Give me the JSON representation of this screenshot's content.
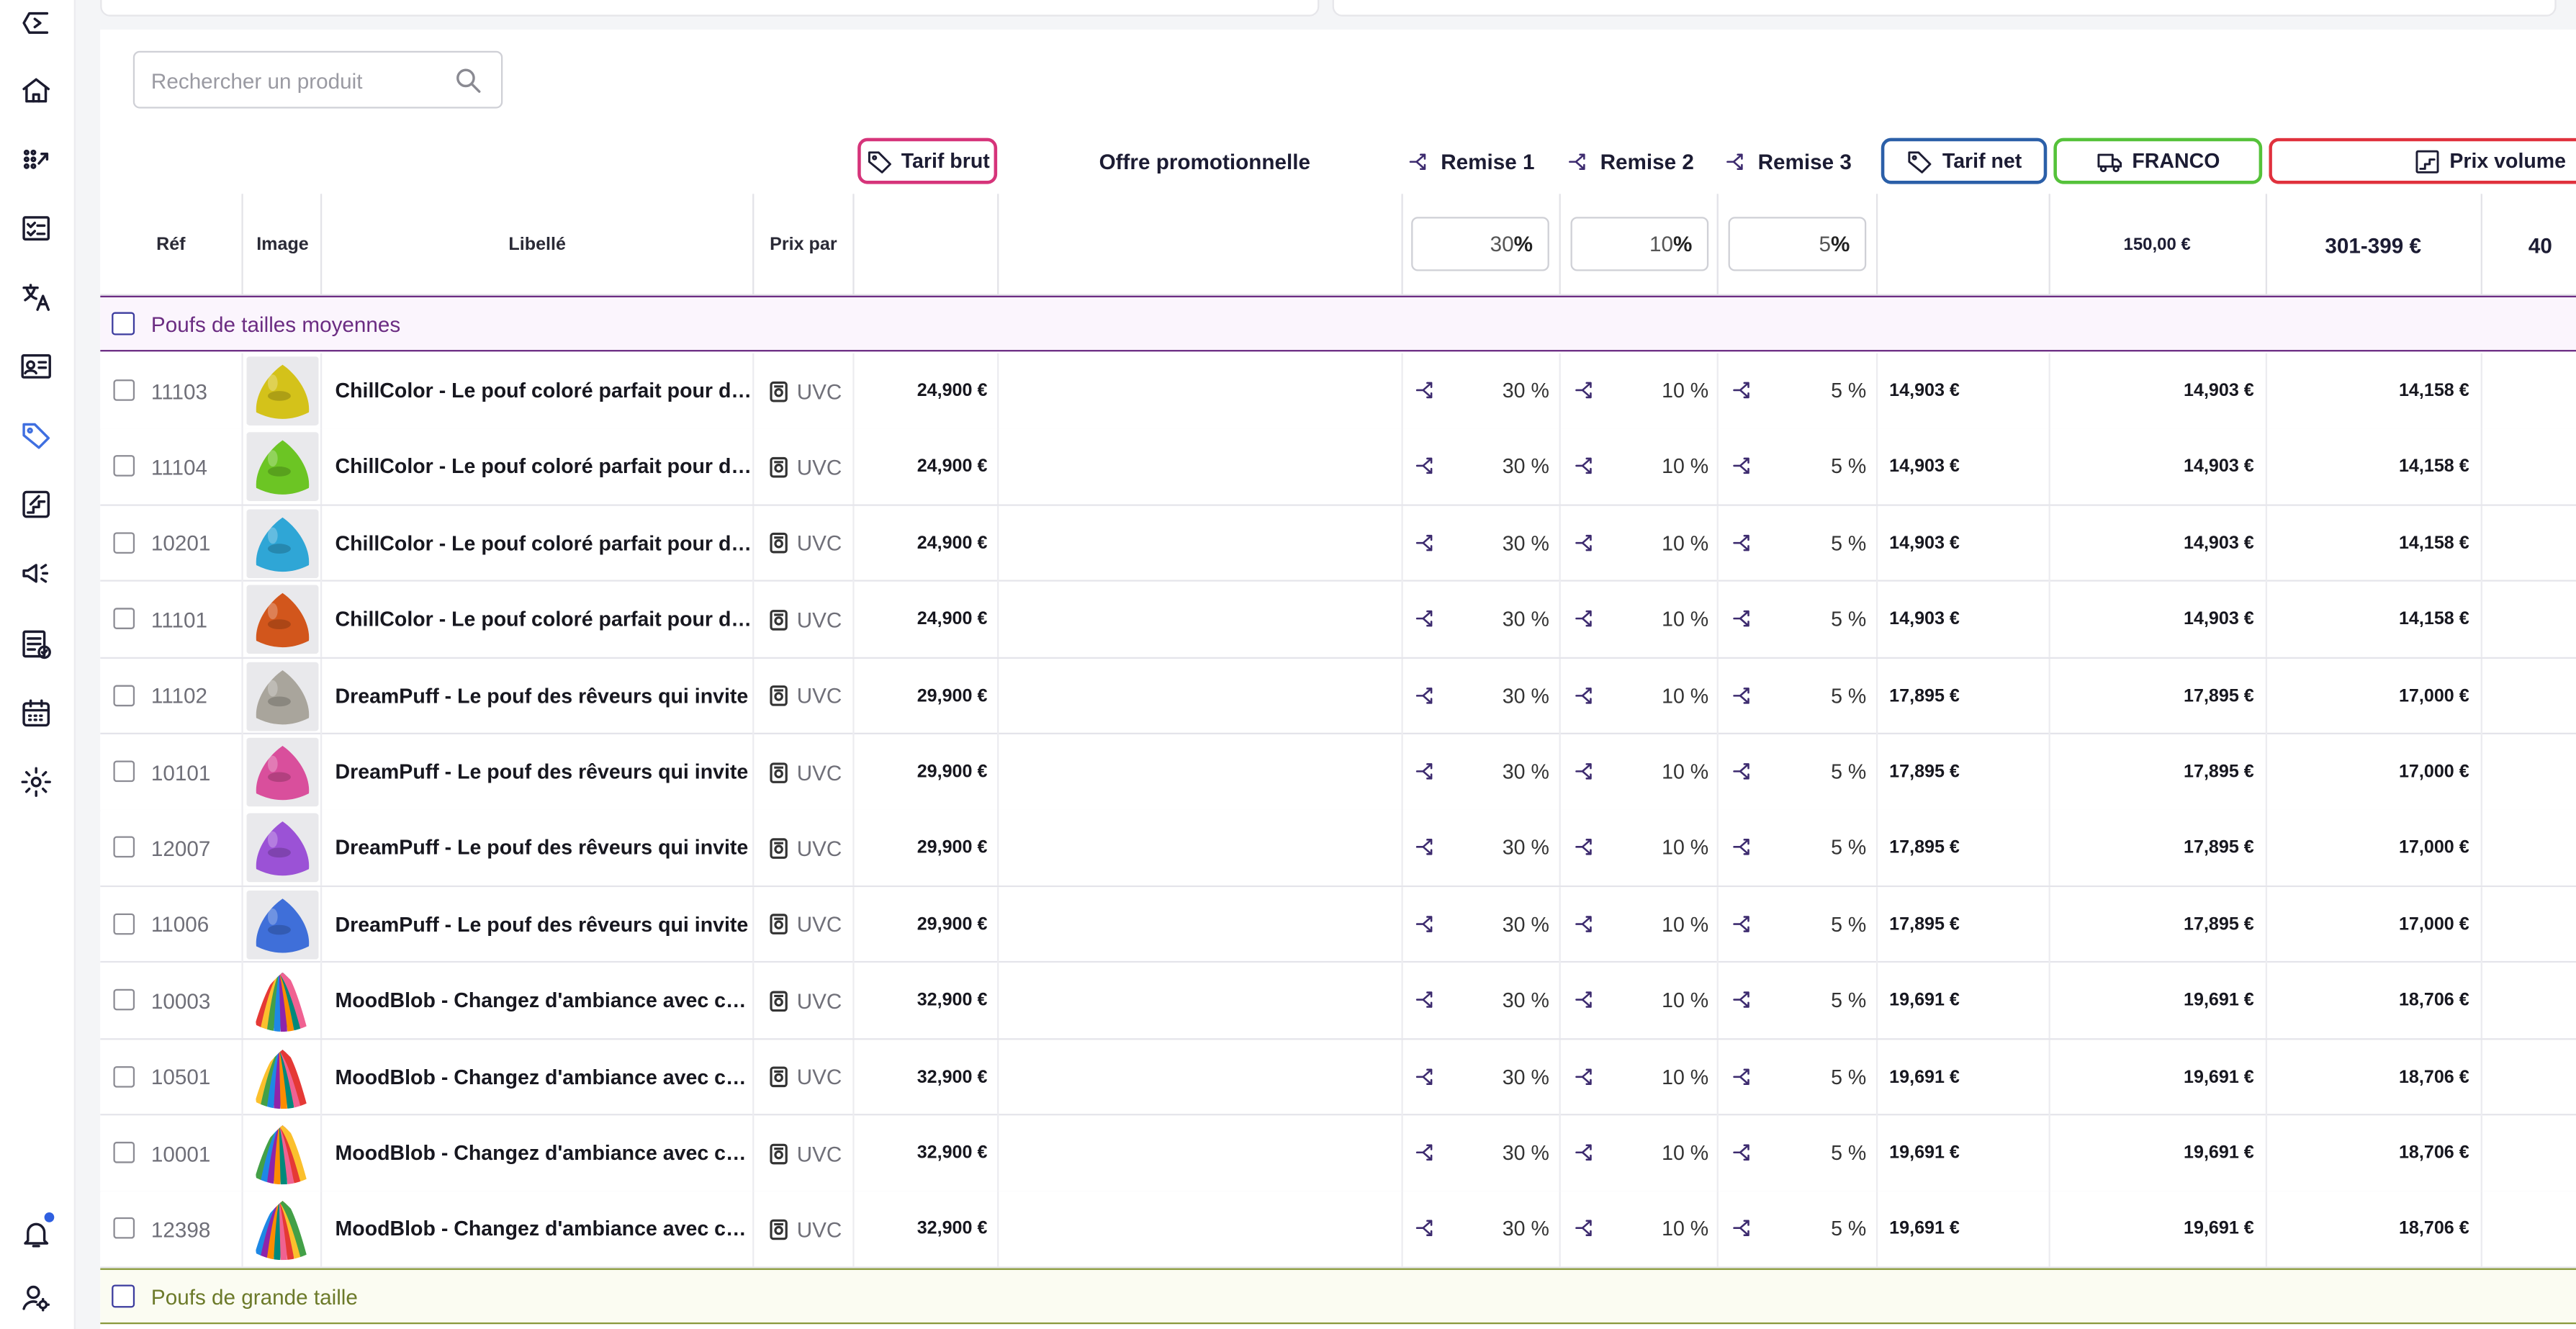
{
  "sidebar": {
    "items": [
      {
        "icon": "back-logo-icon"
      },
      {
        "icon": "home-icon"
      },
      {
        "icon": "dots-grid-icon"
      },
      {
        "icon": "checklist-icon"
      },
      {
        "icon": "translate-icon"
      },
      {
        "icon": "contact-card-icon"
      },
      {
        "icon": "price-tag-icon",
        "active": true
      },
      {
        "icon": "stairs-icon"
      },
      {
        "icon": "megaphone-icon"
      },
      {
        "icon": "document-check-icon"
      },
      {
        "icon": "calendar-icon"
      },
      {
        "icon": "settings-icon"
      }
    ],
    "bottom": [
      {
        "icon": "bell-icon"
      },
      {
        "icon": "user-settings-icon"
      }
    ]
  },
  "search": {
    "placeholder": "Rechercher un produit"
  },
  "header_groups": {
    "tarif_brut": "Tarif brut",
    "offre": "Offre promotionnelle",
    "remise1": "Remise 1",
    "remise2": "Remise 2",
    "remise3": "Remise 3",
    "tarif_net": "Tarif net",
    "franco": "FRANCO",
    "prix_volume": "Prix volume"
  },
  "columns": {
    "ref": "Réf",
    "image": "Image",
    "libelle": "Libellé",
    "prix_par": "Prix par",
    "remise1_value": "30",
    "remise2_value": "10",
    "remise3_value": "5",
    "pct_sign": "%",
    "franco_value": "150,00 €",
    "volume_range": "301-399 €",
    "volume_next": "40"
  },
  "colors": {
    "tarif_brut": "#d6347a",
    "tarif_net": "#2b5fa8",
    "franco": "#55c23a",
    "prix_volume": "#e0313d",
    "group1": "#6b2c82",
    "group2": "#8a9a3c"
  },
  "groups": [
    {
      "label": "Poufs de tailles moyennes"
    },
    {
      "label": "Poufs de grande taille"
    }
  ],
  "rows": [
    {
      "ref": "11103",
      "color": "#d4c21a",
      "libelle": "ChillColor - Le pouf coloré parfait pour détente",
      "unit": "UVC",
      "brut": "24,900 €",
      "r1": "30 %",
      "r2": "10 %",
      "r3": "5 %",
      "net": "14,903 €",
      "franco": "14,903 €",
      "vol": "14,158 €"
    },
    {
      "ref": "11104",
      "color": "#6cc524",
      "libelle": "ChillColor - Le pouf coloré parfait pour détente",
      "unit": "UVC",
      "brut": "24,900 €",
      "r1": "30 %",
      "r2": "10 %",
      "r3": "5 %",
      "net": "14,903 €",
      "franco": "14,903 €",
      "vol": "14,158 €"
    },
    {
      "ref": "10201",
      "color": "#2fa6d6",
      "libelle": "ChillColor - Le pouf coloré parfait pour détente",
      "unit": "UVC",
      "brut": "24,900 €",
      "r1": "30 %",
      "r2": "10 %",
      "r3": "5 %",
      "net": "14,903 €",
      "franco": "14,903 €",
      "vol": "14,158 €"
    },
    {
      "ref": "11101",
      "color": "#d2561c",
      "libelle": "ChillColor - Le pouf coloré parfait pour détente",
      "unit": "UVC",
      "brut": "24,900 €",
      "r1": "30 %",
      "r2": "10 %",
      "r3": "5 %",
      "net": "14,903 €",
      "franco": "14,903 €",
      "vol": "14,158 €"
    },
    {
      "ref": "11102",
      "color": "#a9a59c",
      "libelle": "DreamPuff - Le pouf des rêveurs qui invite",
      "unit": "UVC",
      "brut": "29,900 €",
      "r1": "30 %",
      "r2": "10 %",
      "r3": "5 %",
      "net": "17,895 €",
      "franco": "17,895 €",
      "vol": "17,000 €"
    },
    {
      "ref": "10101",
      "color": "#d94f9c",
      "libelle": "DreamPuff - Le pouf des rêveurs qui invite",
      "unit": "UVC",
      "brut": "29,900 €",
      "r1": "30 %",
      "r2": "10 %",
      "r3": "5 %",
      "net": "17,895 €",
      "franco": "17,895 €",
      "vol": "17,000 €"
    },
    {
      "ref": "12007",
      "color": "#9b52d6",
      "libelle": "DreamPuff - Le pouf des rêveurs qui invite",
      "unit": "UVC",
      "brut": "29,900 €",
      "r1": "30 %",
      "r2": "10 %",
      "r3": "5 %",
      "net": "17,895 €",
      "franco": "17,895 €",
      "vol": "17,000 €"
    },
    {
      "ref": "11006",
      "color": "#3f6fd9",
      "libelle": "DreamPuff - Le pouf des rêveurs qui invite",
      "unit": "UVC",
      "brut": "29,900 €",
      "r1": "30 %",
      "r2": "10 %",
      "r3": "5 %",
      "net": "17,895 €",
      "franco": "17,895 €",
      "vol": "17,000 €"
    },
    {
      "ref": "10003",
      "color": "striped",
      "libelle": "MoodBlob - Changez d'ambiance avec ce pouf",
      "unit": "UVC",
      "brut": "32,900 €",
      "r1": "30 %",
      "r2": "10 %",
      "r3": "5 %",
      "net": "19,691 €",
      "franco": "19,691 €",
      "vol": "18,706 €"
    },
    {
      "ref": "10501",
      "color": "striped",
      "libelle": "MoodBlob - Changez d'ambiance avec ce pouf",
      "unit": "UVC",
      "brut": "32,900 €",
      "r1": "30 %",
      "r2": "10 %",
      "r3": "5 %",
      "net": "19,691 €",
      "franco": "19,691 €",
      "vol": "18,706 €"
    },
    {
      "ref": "10001",
      "color": "striped",
      "libelle": "MoodBlob - Changez d'ambiance avec ce pouf",
      "unit": "UVC",
      "brut": "32,900 €",
      "r1": "30 %",
      "r2": "10 %",
      "r3": "5 %",
      "net": "19,691 €",
      "franco": "19,691 €",
      "vol": "18,706 €"
    },
    {
      "ref": "12398",
      "color": "striped",
      "libelle": "MoodBlob - Changez d'ambiance avec ce pouf",
      "unit": "UVC",
      "brut": "32,900 €",
      "r1": "30 %",
      "r2": "10 %",
      "r3": "5 %",
      "net": "19,691 €",
      "franco": "19,691 €",
      "vol": "18,706 €"
    }
  ]
}
